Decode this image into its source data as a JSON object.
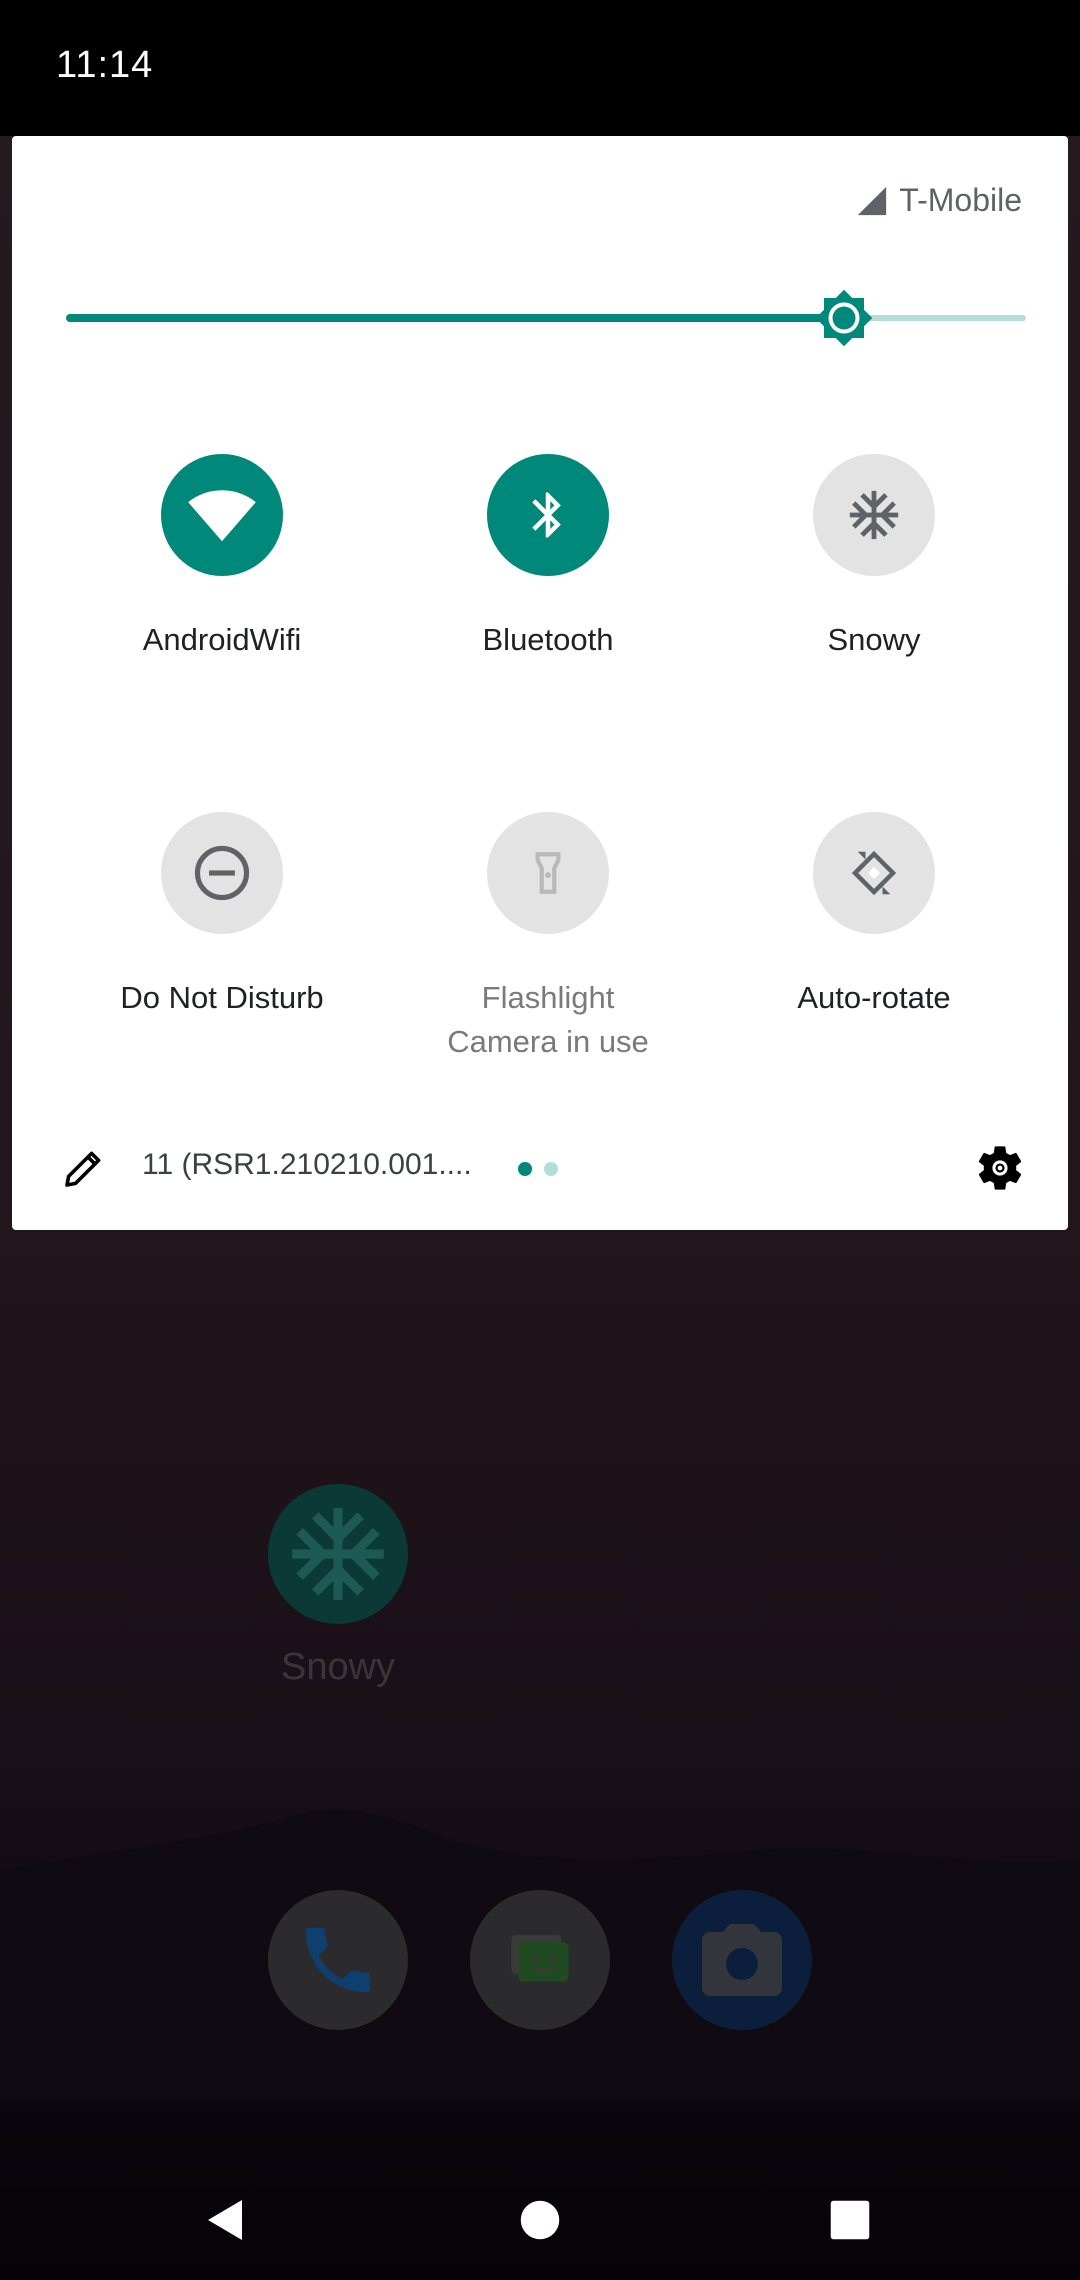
{
  "status_bar": {
    "time": "11:14"
  },
  "quick_settings": {
    "carrier": "T-Mobile",
    "brightness_level": 0.81,
    "tiles": [
      {
        "label": "AndroidWifi",
        "icon": "wifi-icon",
        "state": "on"
      },
      {
        "label": "Bluetooth",
        "icon": "bluetooth-icon",
        "state": "on"
      },
      {
        "label": "Snowy",
        "icon": "snowflake-icon",
        "state": "off"
      },
      {
        "label": "Do Not Disturb",
        "icon": "do-not-disturb-icon",
        "state": "off"
      },
      {
        "label": "Flashlight",
        "sublabel": "Camera in use",
        "icon": "flashlight-icon",
        "state": "unavailable"
      },
      {
        "label": "Auto-rotate",
        "icon": "auto-rotate-icon",
        "state": "off"
      }
    ],
    "footer": {
      "build_text": "11 (RSR1.210210.001....",
      "page_count": 2,
      "current_page": 1
    }
  },
  "home_screen": {
    "app": {
      "label": "Snowy",
      "icon": "snowflake-icon"
    },
    "dock": [
      {
        "icon": "phone-icon"
      },
      {
        "icon": "messages-icon"
      },
      {
        "icon": "camera-icon"
      }
    ]
  },
  "navigation": {
    "buttons": [
      "back-icon",
      "home-icon",
      "recents-icon"
    ]
  },
  "colors": {
    "accent": "#00897b",
    "accent_light": "#b2ded8",
    "tile_off": "#e3e3e3",
    "panel": "#ffffff"
  }
}
